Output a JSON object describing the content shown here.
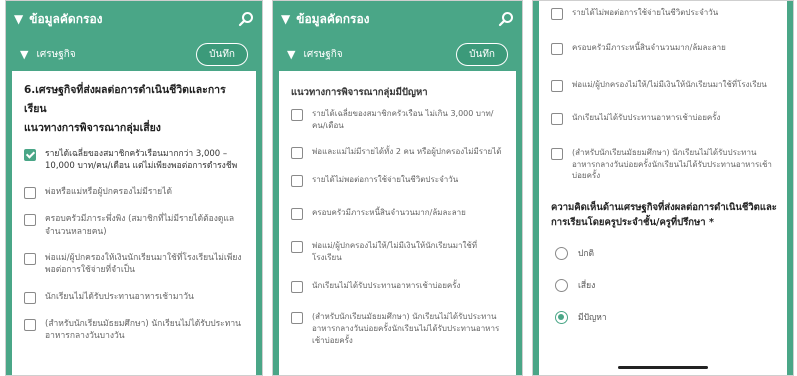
{
  "header": {
    "title": "ข้อมูลคัดกรอง"
  },
  "section": {
    "label": "เศรษฐกิจ",
    "save_label": "บันทึก"
  },
  "panel1": {
    "question": "6.เศรษฐกิจที่ส่งผลต่อการดำเนินชีวิตและการเรียน",
    "criteria": "แนวทางการพิจารณากลุ่มเสี่ยง",
    "options": [
      {
        "text": "รายได้เฉลี่ยของสมาชิกครัวเรือนมากกว่า 3,000 – 10,000 บาท/คน/เดือน แต่ไม่เพียงพอต่อการดำรงชีพ",
        "checked": true
      },
      {
        "text": "พ่อหรือแม่หรือผู้ปกครองไม่มีรายได้",
        "checked": false
      },
      {
        "text": "ครอบครัวมีภาระพึ่งพิง (สมาชิกที่ไม่มีรายได้ต้องดูแล จำนวนหลายคน)",
        "checked": false
      },
      {
        "text": "พ่อแม่/ผู้ปกครองให้เงินนักเรียนมาใช้ที่โรงเรียนไม่เพียงพอต่อการใช้จ่ายที่จำเป็น",
        "checked": false
      },
      {
        "text": "นักเรียนไม่ได้รับประทานอาหารเช้ามาวัน",
        "checked": false
      },
      {
        "text": "(สำหรับนักเรียนมัธยมศึกษา) นักเรียนไม่ได้รับประทานอาหารกลางวันบางวัน",
        "checked": false
      }
    ]
  },
  "panel2": {
    "criteria": "แนวทางการพิจารณากลุ่มมีปัญหา",
    "options": [
      {
        "text": "รายได้เฉลี่ยของสมาชิกครัวเรือน ไม่เกิน 3,000 บาท/คน/เดือน",
        "checked": false
      },
      {
        "text": "พ่อและแม่ไม่มีรายได้ทั้ง 2 คน หรือผู้ปกครองไม่มีรายได้",
        "checked": false
      },
      {
        "text": "รายได้ไม่พอต่อการใช้จ่ายในชีวิตประจำวัน",
        "checked": false
      },
      {
        "text": "ครอบครัวมีภาระหนี้สินจำนวนมาก/ล้มละลาย",
        "checked": false
      },
      {
        "text": "พ่อแม่/ผู้ปกครองไม่ให้/ไม่มีเงินให้นักเรียนมาใช้ที่โรงเรียน",
        "checked": false
      },
      {
        "text": "นักเรียนไม่ได้รับประทานอาหารเช้าบ่อยครั้ง",
        "checked": false
      },
      {
        "text": "(สำหรับนักเรียนมัธยมศึกษา) นักเรียนไม่ได้รับประทานอาหารกลางวันบ่อยครั้งนักเรียนไม่ได้รับประทานอาหารเช้าบ่อยครั้ง",
        "checked": false
      }
    ]
  },
  "panel3": {
    "options": [
      {
        "text": "รายได้ไม่พอต่อการใช้จ่ายในชีวิตประจำวัน",
        "checked": false
      },
      {
        "text": "ครอบครัวมีภาระหนี้สินจำนวนมาก/ล้มละลาย",
        "checked": false
      },
      {
        "text": "พ่อแม่/ผู้ปกครองไม่ให้/ไม่มีเงินให้นักเรียนมาใช้ที่โรงเรียน",
        "checked": false
      },
      {
        "text": "นักเรียนไม่ได้รับประทานอาหารเช้าบ่อยครั้ง",
        "checked": false
      },
      {
        "text": "(สำหรับนักเรียนมัธยมศึกษา) นักเรียนไม่ได้รับประทานอาหารกลางวันบ่อยครั้งนักเรียนไม่ได้รับประทานอาหารเช้าบ่อยครั้ง",
        "checked": false
      }
    ],
    "opinion_question": "ความคิดเห็นด้านเศรษฐกิจที่ส่งผลต่อการดำเนินชีวิตและการเรียนโดยครูประจำชั้น/ครูที่ปรึกษา *",
    "radios": [
      {
        "text": "ปกติ",
        "selected": false
      },
      {
        "text": "เสี่ยง",
        "selected": false
      },
      {
        "text": "มีปัญหา",
        "selected": true
      }
    ]
  },
  "colors": {
    "accent": "#4aa687"
  }
}
